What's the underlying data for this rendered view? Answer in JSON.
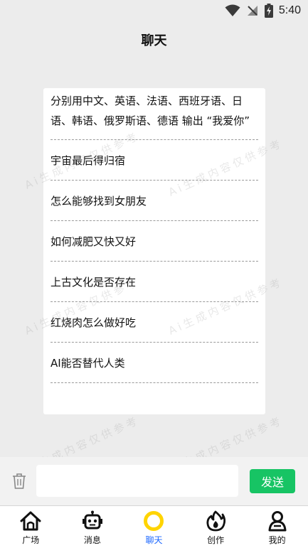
{
  "status_bar": {
    "time": "5:40"
  },
  "header": {
    "title": "聊天"
  },
  "questions": [
    "分别用中文、英语、法语、西班牙语、日语、韩语、俄罗斯语、德语 输出 “我爱你”",
    "宇宙最后得归宿",
    "怎么能够找到女朋友",
    "如何减肥又快又好",
    "上古文化是否存在",
    "红烧肉怎么做好吃",
    "AI能否替代人类"
  ],
  "watermark_text": "Ai生成内容仅供参考",
  "input": {
    "value": "",
    "placeholder": "",
    "send_label": "发送"
  },
  "tabs": [
    {
      "label": "广场",
      "icon": "home-icon"
    },
    {
      "label": "消息",
      "icon": "robot-icon"
    },
    {
      "label": "聊天",
      "icon": "chat-ring-icon"
    },
    {
      "label": "创作",
      "icon": "flame-icon"
    },
    {
      "label": "我的",
      "icon": "user-icon"
    }
  ],
  "active_tab": "聊天",
  "colors": {
    "accent_blue": "#1a66ff",
    "send_green": "#17c464",
    "active_ring": "#ffd400"
  }
}
